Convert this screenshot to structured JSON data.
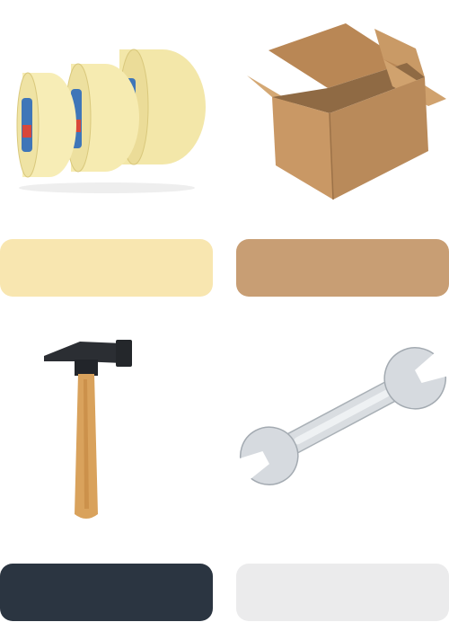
{
  "items": [
    {
      "icon": "masking-tape-icon",
      "color": "#f8e6b0"
    },
    {
      "icon": "cardboard-box-icon",
      "color": "#c89e74"
    },
    {
      "icon": "hammer-icon",
      "color": "#2b3541"
    },
    {
      "icon": "wrench-icon",
      "color": "#ebebec"
    }
  ]
}
